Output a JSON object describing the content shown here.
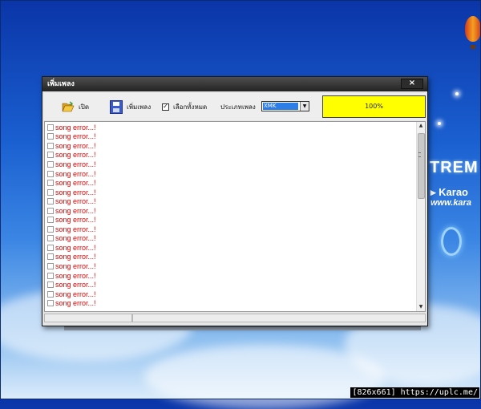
{
  "window": {
    "title": "เพิ่มเพลง",
    "close": "×"
  },
  "toolbar": {
    "open_label": "เปิด",
    "add_song_label": "เพิ่มเพลง",
    "select_all_label": "เลือกทั้งหมด",
    "select_all_checked": true,
    "song_type_label": "ประเภทเพลง",
    "song_type_value": "XMK",
    "progress_text": "100%"
  },
  "songs": [
    "song error...!",
    "song error...!",
    "song error...!",
    "song error...!",
    "song error...!",
    "song error...!",
    "song error...!",
    "song error...!",
    "song error...!",
    "song error...!",
    "song error...!",
    "song error...!",
    "song error...!",
    "song error...!",
    "song error...!",
    "song error...!",
    "song error...!",
    "song error...!",
    "song error...!",
    "song error...!"
  ],
  "desktop": {
    "brand_line1": "TREM",
    "brand_line2": "▸ Karao",
    "brand_line3": "www.kara"
  },
  "watermark": "[826x661] https://uplc.me/",
  "colors": {
    "error_text": "#e00000",
    "progress_fill": "#ffff00",
    "select_highlight": "#2d7de6"
  }
}
